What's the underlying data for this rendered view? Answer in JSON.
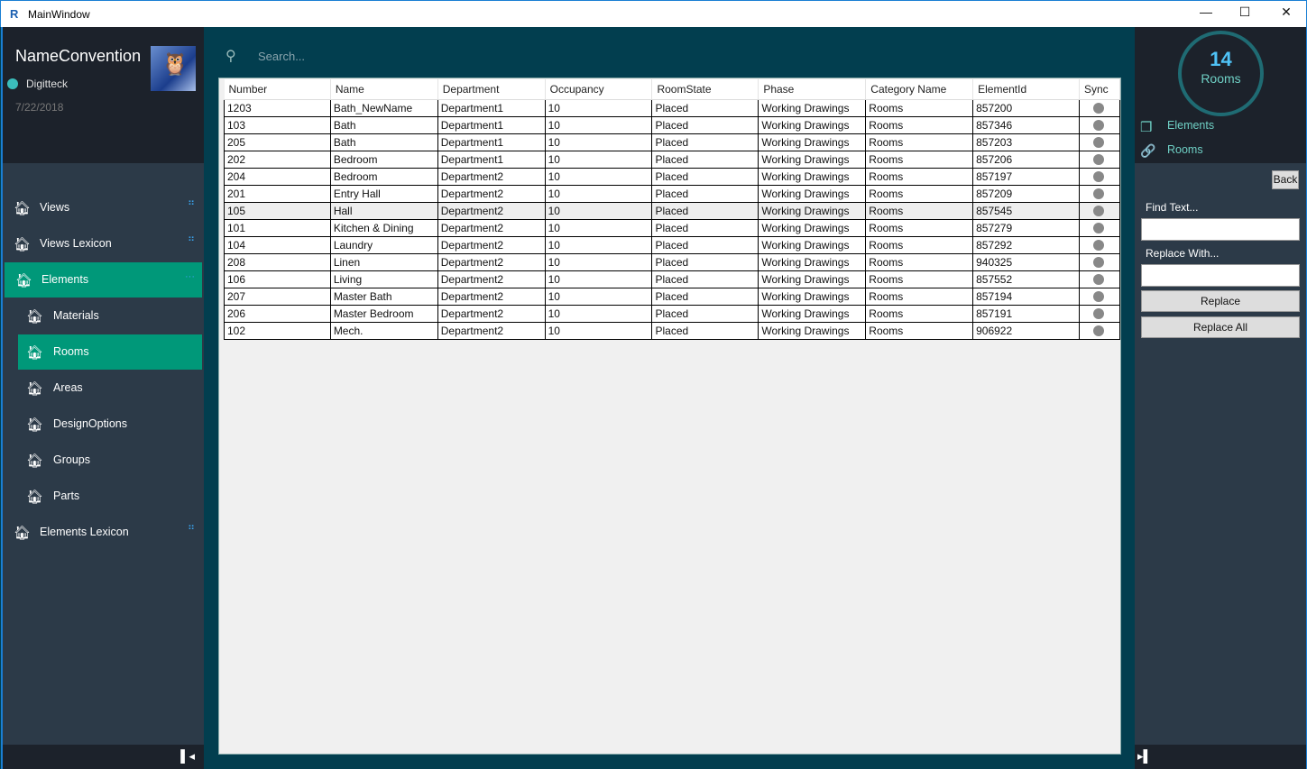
{
  "window": {
    "title": "MainWindow",
    "minimize": "—",
    "maximize": "☐",
    "close": "✕"
  },
  "sidebar": {
    "app_name": "NameConvention",
    "user": "Digitteck",
    "date": "7/22/2018",
    "items": [
      {
        "label": "Views",
        "selected": false,
        "sub": false,
        "marker": "⠛"
      },
      {
        "label": "Views Lexicon",
        "selected": false,
        "sub": false,
        "marker": "⠛"
      },
      {
        "label": "Elements",
        "selected": true,
        "sub": false,
        "marker": "···"
      },
      {
        "label": "Materials",
        "selected": false,
        "sub": true,
        "marker": ""
      },
      {
        "label": "Rooms",
        "selected": true,
        "sub": true,
        "marker": ""
      },
      {
        "label": "Areas",
        "selected": false,
        "sub": true,
        "marker": ""
      },
      {
        "label": "DesignOptions",
        "selected": false,
        "sub": true,
        "marker": ""
      },
      {
        "label": "Groups",
        "selected": false,
        "sub": true,
        "marker": ""
      },
      {
        "label": "Parts",
        "selected": false,
        "sub": true,
        "marker": ""
      },
      {
        "label": "Elements Lexicon",
        "selected": false,
        "sub": false,
        "marker": "⠛"
      }
    ],
    "collapse": "▌◂"
  },
  "search": {
    "placeholder": "Search..."
  },
  "grid": {
    "columns": [
      "Number",
      "Name",
      "Department",
      "Occupancy",
      "RoomState",
      "Phase",
      "Category Name",
      "ElementId",
      "Sync"
    ],
    "rows": [
      [
        "1203",
        "Bath_NewName",
        "Department1",
        "10",
        "Placed",
        "Working Drawings",
        "Rooms",
        "857200"
      ],
      [
        "103",
        "Bath",
        "Department1",
        "10",
        "Placed",
        "Working Drawings",
        "Rooms",
        "857346"
      ],
      [
        "205",
        "Bath",
        "Department1",
        "10",
        "Placed",
        "Working Drawings",
        "Rooms",
        "857203"
      ],
      [
        "202",
        "Bedroom",
        "Department1",
        "10",
        "Placed",
        "Working Drawings",
        "Rooms",
        "857206"
      ],
      [
        "204",
        "Bedroom",
        "Department2",
        "10",
        "Placed",
        "Working Drawings",
        "Rooms",
        "857197"
      ],
      [
        "201",
        "Entry Hall",
        "Department2",
        "10",
        "Placed",
        "Working Drawings",
        "Rooms",
        "857209"
      ],
      [
        "105",
        "Hall",
        "Department2",
        "10",
        "Placed",
        "Working Drawings",
        "Rooms",
        "857545"
      ],
      [
        "101",
        "Kitchen & Dining",
        "Department2",
        "10",
        "Placed",
        "Working Drawings",
        "Rooms",
        "857279"
      ],
      [
        "104",
        "Laundry",
        "Department2",
        "10",
        "Placed",
        "Working Drawings",
        "Rooms",
        "857292"
      ],
      [
        "208",
        "Linen",
        "Department2",
        "10",
        "Placed",
        "Working Drawings",
        "Rooms",
        "940325"
      ],
      [
        "106",
        "Living",
        "Department2",
        "10",
        "Placed",
        "Working Drawings",
        "Rooms",
        "857552"
      ],
      [
        "207",
        "Master Bath",
        "Department2",
        "10",
        "Placed",
        "Working Drawings",
        "Rooms",
        "857194"
      ],
      [
        "206",
        "Master Bedroom",
        "Department2",
        "10",
        "Placed",
        "Working Drawings",
        "Rooms",
        "857191"
      ],
      [
        "102",
        "Mech.",
        "Department2",
        "10",
        "Placed",
        "Working Drawings",
        "Rooms",
        "906922"
      ]
    ],
    "highlighted_row": 6
  },
  "right": {
    "count": "14",
    "count_label": "Rooms",
    "links": [
      "Elements",
      "Rooms"
    ],
    "back": "Back",
    "find_label": "Find Text...",
    "find_value": "",
    "replace_label": "Replace With...",
    "replace_value": "",
    "replace": "Replace",
    "replace_all": "Replace All",
    "expand": "▸▌"
  },
  "colors": {
    "accent": "#009879",
    "main_bg": "#023e4f",
    "sidebar": "#2c3a48",
    "header": "#1c222b"
  }
}
